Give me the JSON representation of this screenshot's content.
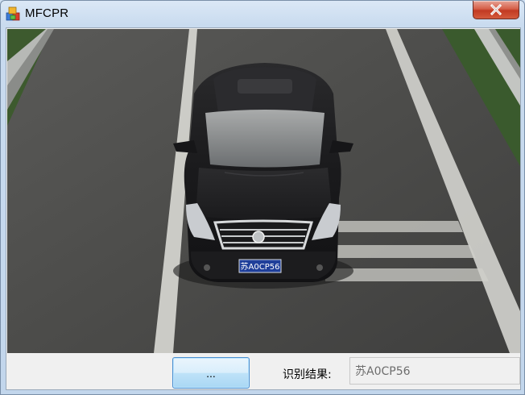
{
  "window": {
    "title": "MFCPR",
    "close_symbol": "×"
  },
  "icons": {
    "app": "app-logo-icon",
    "close": "close-icon"
  },
  "image_view": {
    "description_icon": "car-photo",
    "plate_text": "苏A0CP56"
  },
  "controls": {
    "browse_label": "...",
    "result_label": "识别结果:",
    "result_value": "苏A0CP56"
  },
  "colors": {
    "close_button": "#c8432b",
    "accent_button_border": "#4a8fd0",
    "plate_blue": "#1f3f9a"
  }
}
